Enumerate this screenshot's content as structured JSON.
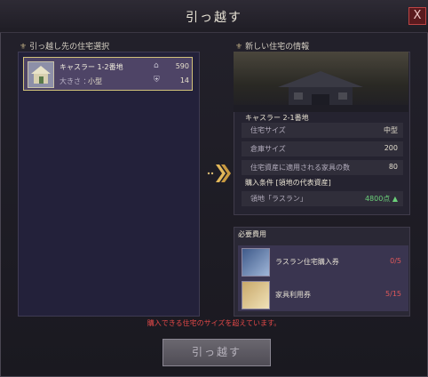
{
  "window": {
    "title": "引っ越す",
    "close_label": "X"
  },
  "left": {
    "section_title": "引っ越し先の住宅選択",
    "house": {
      "name": "キャスラー 1-2番地",
      "size_label": "大きさ ：",
      "size_value": "小型",
      "stat1": "590",
      "stat2": "14",
      "stat1_icon": "house-icon",
      "stat2_icon": "shield-icon"
    }
  },
  "right": {
    "section_title": "新しい住宅の情報",
    "house_name": "キャスラー 2-1番地",
    "rows": [
      {
        "key": "住宅サイズ",
        "value": "中型"
      },
      {
        "key": "倉庫サイズ",
        "value": "200"
      },
      {
        "key": "住宅資産に適用される家具の数",
        "value": "80"
      }
    ],
    "condition_title": "購入条件 [領地の代表資産]",
    "condition": {
      "key": "領地「ラスラン」",
      "value": "4800点 ▲"
    }
  },
  "cost": {
    "section_title": "必要費用",
    "items": [
      {
        "label": "ラスラン住宅購入券",
        "count": "0/5"
      },
      {
        "label": "家具利用券",
        "count": "5/15"
      }
    ]
  },
  "warning": "購入できる住宅のサイズを超えています。",
  "move_button": "引っ越す",
  "colors": {
    "accent_gold": "#d2c27a",
    "warning_red": "#e04848",
    "positive_green": "#6bd07a"
  }
}
